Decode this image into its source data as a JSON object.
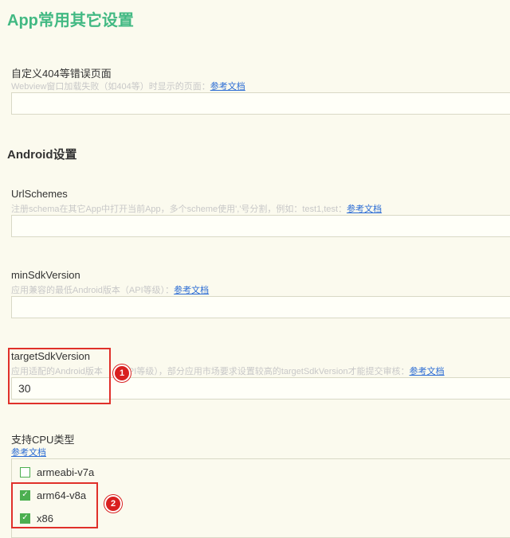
{
  "page": {
    "title": "App常用其它设置"
  },
  "error_page": {
    "label": "自定义404等错误页面",
    "desc": "Webview窗口加载失败（如404等）时显示的页面：",
    "link": "参考文档",
    "value": ""
  },
  "android": {
    "section_title": "Android设置",
    "url_schemes": {
      "label": "UrlSchemes",
      "desc": "注册schema在其它App中打开当前App，多个scheme使用','号分割，例如：test1,test：",
      "link": "参考文档",
      "value": ""
    },
    "min_sdk": {
      "label": "minSdkVersion",
      "desc": "应用兼容的最低Android版本（API等级）：",
      "link": "参考文档",
      "value": ""
    },
    "target_sdk": {
      "label": "targetSdkVersion",
      "desc_part1": "应用适配的Android版本",
      "desc_part2": "PI等级），部分应用市场要求设置较高的targetSdkVersion才能提交审核：",
      "link": "参考文档",
      "value": "30"
    },
    "cpu": {
      "label": "支持CPU类型",
      "link": "参考文档",
      "options": [
        {
          "label": "armeabi-v7a",
          "checked": false
        },
        {
          "label": "arm64-v8a",
          "checked": true
        },
        {
          "label": "x86",
          "checked": true
        }
      ]
    }
  },
  "annotations": {
    "badge1": "1",
    "badge2": "2",
    "color": "#e0302a"
  },
  "colors": {
    "accent": "#42b983",
    "background": "#fbfaee",
    "link": "#2a6bd4",
    "checkbox": "#4caf50"
  }
}
